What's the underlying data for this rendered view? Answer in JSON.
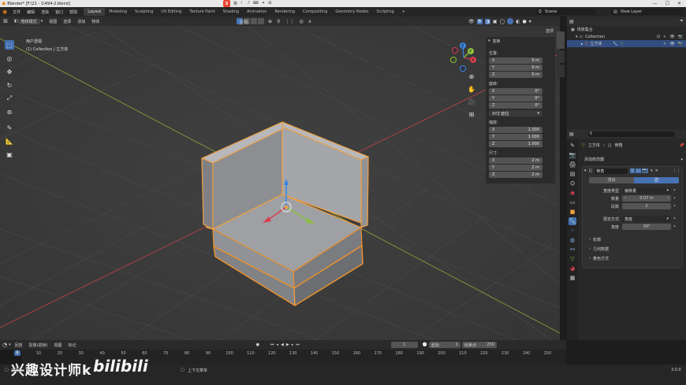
{
  "window": {
    "title": "Blender* [F:\\21 - 1\\494-2.blend]"
  },
  "menu": {
    "items": [
      "文件",
      "编辑",
      "渲染",
      "窗口",
      "帮助"
    ],
    "workspaces": [
      "Layout",
      "Modeling",
      "Sculpting",
      "UV Editing",
      "Texture Paint",
      "Shading",
      "Animation",
      "Rendering",
      "Compositing",
      "Geometry Nodes",
      "Scripting"
    ],
    "add_tab": "+",
    "scene_name": "Scene",
    "view_layer": "View Layer"
  },
  "viewport": {
    "mode": "物体模式",
    "menus": [
      "视图",
      "选择",
      "添加",
      "物体"
    ],
    "orientation": "全局",
    "overlay_title": "用户透视",
    "overlay_subtitle": "(1) Collection | 立方体",
    "options_label": "选项",
    "gizmo": {
      "x": "X",
      "y": "Y",
      "z": "Z"
    }
  },
  "npanel": {
    "header": "变换",
    "location_label": "位置:",
    "location": [
      {
        "axis": "X",
        "value": "0 m"
      },
      {
        "axis": "Y",
        "value": "0 m"
      },
      {
        "axis": "Z",
        "value": "0 m"
      }
    ],
    "rotation_label": "旋转:",
    "rotation": [
      {
        "axis": "X",
        "value": "0°"
      },
      {
        "axis": "Y",
        "value": "0°"
      },
      {
        "axis": "Z",
        "value": "0°"
      }
    ],
    "rotation_mode": "XYZ 欧拉",
    "scale_label": "缩放:",
    "scale": [
      {
        "axis": "X",
        "value": "1.000"
      },
      {
        "axis": "Y",
        "value": "1.000"
      },
      {
        "axis": "Z",
        "value": "1.000"
      }
    ],
    "dimensions_label": "尺寸:",
    "dimensions": [
      {
        "axis": "X",
        "value": "2 m"
      },
      {
        "axis": "Y",
        "value": "2 m"
      },
      {
        "axis": "Z",
        "value": "2 m"
      }
    ]
  },
  "outliner": {
    "root": "场景集合",
    "collection": "Collection",
    "object": "立方体"
  },
  "properties": {
    "object_name": "立方体",
    "modifier_target": "倒角",
    "add_modifier": "添加修改器",
    "modifier_name": "倒角",
    "affect_vertices": "顶点",
    "affect_edges": "边",
    "width_type_label": "宽度类型",
    "width_type": "偏移量",
    "amount_label": "数量",
    "amount": "0.07 m",
    "segments_label": "段数",
    "segments": "2",
    "limit_method_label": "限定方式",
    "limit_method": "角度",
    "angle_label": "角度",
    "angle": "30°",
    "sections": [
      "轮廓",
      "几何数据",
      "着色方式"
    ]
  },
  "timeline": {
    "menus": [
      "回放",
      "抠像(插帧)",
      "视图",
      "标记"
    ],
    "current_frame": "1",
    "start_label": "起始",
    "start": "1",
    "end_label": "结束点",
    "end": "250",
    "ticks": [
      "0",
      "10",
      "20",
      "30",
      "40",
      "50",
      "60",
      "70",
      "80",
      "90",
      "100",
      "110",
      "120",
      "130",
      "140",
      "150",
      "160",
      "170",
      "180",
      "190",
      "200",
      "210",
      "220",
      "230",
      "240",
      "250"
    ]
  },
  "status": {
    "watermark": "兴趣设计师k",
    "brand": "bilibili",
    "hint_select": "选择",
    "hint_menu": "上下文菜单",
    "version": "3.0.0"
  },
  "colors": {
    "accent": "#4772b3",
    "selection": "#e8902e",
    "x_axis": "#d8404e",
    "y_axis": "#8cc23a",
    "z_axis": "#3a88e0"
  }
}
